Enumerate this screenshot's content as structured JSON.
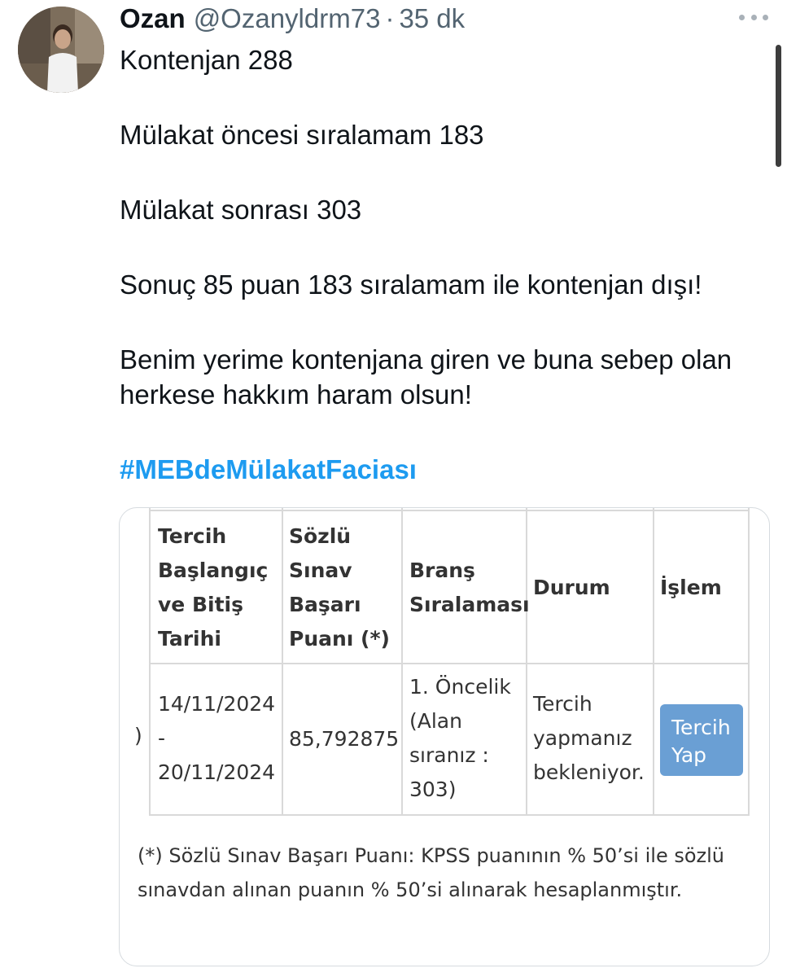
{
  "tweet": {
    "display_name": "Ozan",
    "handle": "@Ozanyldrm73",
    "separator": "·",
    "time": "35 dk",
    "paragraphs": [
      "Kontenjan 288",
      "Mülakat öncesi sıralamam 183",
      "Mülakat sonrası 303",
      "Sonuç 85 puan 183 sıralamam ile kontenjan dışı!",
      "Benim yerime kontenjana giren ve buna sebep olan herkese hakkım haram olsun!"
    ],
    "hashtag": "#MEBdeMülakatFaciası",
    "colors": {
      "hashtag": "#1d9bf0",
      "secondary_text": "#536471",
      "button": "#6a9fd4"
    }
  },
  "media": {
    "table": {
      "headers": {
        "tercih_line1": "Tercih",
        "tercih_line2": "Başlangıç",
        "tercih_line3": "ve Bitiş",
        "tercih_line4": "Tarihi",
        "sozlu_line1": "Sözlü",
        "sozlu_line2": "Sınav",
        "sozlu_line3": "Başarı",
        "sozlu_line4": "Puanı (*)",
        "brans_line1": "Branş",
        "brans_line2": "Sıralaması",
        "durum": "Durum",
        "islem": "İşlem"
      },
      "row": {
        "cut_prefix": ")",
        "date_start": "14/11/2024",
        "date_dash": "-",
        "date_end": "20/11/2024",
        "score": "85,792875",
        "brans_line1": "1. Öncelik",
        "brans_line2": "(Alan",
        "brans_line3": "sıranız :",
        "brans_line4": "303)",
        "durum_line1": "Tercih",
        "durum_line2": "yapmanız",
        "durum_line3": "bekleniyor.",
        "button_line1": "Tercih",
        "button_line2": "Yap"
      }
    },
    "footnote": "(*) Sözlü Sınav Başarı Puanı: KPSS puanının % 50’si ile sözlü sınavdan alınan puanın % 50’si alınarak hesaplanmıştır."
  }
}
